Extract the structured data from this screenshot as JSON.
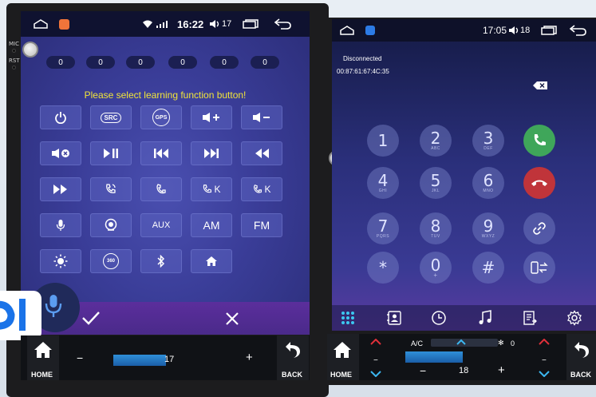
{
  "left_device": {
    "side_labels": [
      "MIC",
      "RST"
    ],
    "status": {
      "time": "16:22",
      "volume": "17"
    },
    "counters": [
      "0",
      "0",
      "0",
      "0",
      "0",
      "0"
    ],
    "prompt": "Please select learning function button!",
    "buttons": [
      {
        "label": "",
        "icon": "power-icon"
      },
      {
        "label": "SRC",
        "icon": "src-icon"
      },
      {
        "label": "GPS",
        "icon": "gps-icon"
      },
      {
        "label": "",
        "icon": "volume-up-icon"
      },
      {
        "label": "",
        "icon": "volume-down-icon"
      },
      {
        "label": "",
        "icon": "mute-icon"
      },
      {
        "label": "",
        "icon": "play-pause-icon"
      },
      {
        "label": "",
        "icon": "previous-track-icon"
      },
      {
        "label": "",
        "icon": "next-track-icon"
      },
      {
        "label": "",
        "icon": "rewind-icon"
      },
      {
        "label": "",
        "icon": "fast-forward-icon"
      },
      {
        "label": "",
        "icon": "phone-answer-icon"
      },
      {
        "label": "",
        "icon": "phone-hangup-icon"
      },
      {
        "label": "K",
        "icon": "phone-answer-k-icon"
      },
      {
        "label": "K",
        "icon": "phone-hangup-k-icon"
      },
      {
        "label": "",
        "icon": "microphone-icon"
      },
      {
        "label": "",
        "icon": "camera-icon"
      },
      {
        "label": "AUX",
        "icon": "aux-icon"
      },
      {
        "label": "AM",
        "icon": "am-icon"
      },
      {
        "label": "FM",
        "icon": "fm-icon"
      },
      {
        "label": "",
        "icon": "brightness-icon"
      },
      {
        "label": "360",
        "icon": "camera-360-icon"
      },
      {
        "label": "",
        "icon": "bluetooth-icon"
      },
      {
        "label": "",
        "icon": "home-icon"
      }
    ],
    "hw": {
      "home_label": "HOME",
      "back_label": "BACK",
      "minus": "−",
      "plus": "+",
      "temp": "17"
    }
  },
  "right_device": {
    "status": {
      "time": "17:05",
      "volume": "18"
    },
    "connection": "Disconnected",
    "mac": "00:87:61:67:4C:35",
    "keys": [
      {
        "digit": "1",
        "sub": ""
      },
      {
        "digit": "2",
        "sub": "ABC"
      },
      {
        "digit": "3",
        "sub": "DEF"
      },
      {
        "digit": "4",
        "sub": "GHI"
      },
      {
        "digit": "5",
        "sub": "JKL"
      },
      {
        "digit": "6",
        "sub": "MNO"
      },
      {
        "digit": "7",
        "sub": "PQRS"
      },
      {
        "digit": "8",
        "sub": "TUV"
      },
      {
        "digit": "9",
        "sub": "WXYZ"
      },
      {
        "digit": "*",
        "sub": ""
      },
      {
        "digit": "0",
        "sub": "+"
      },
      {
        "digit": "#",
        "sub": ""
      }
    ],
    "hw": {
      "home_label": "HOME",
      "back_label": "BACK",
      "ac_label": "A/C",
      "fan_value": "0",
      "minus": "−",
      "plus": "+",
      "temp": "18"
    }
  },
  "colors": {
    "prompt_yellow": "#f1e43a",
    "call_green": "#3fa65a",
    "hangup_red": "#c0343a",
    "logo_blue": "#1a73e8"
  }
}
